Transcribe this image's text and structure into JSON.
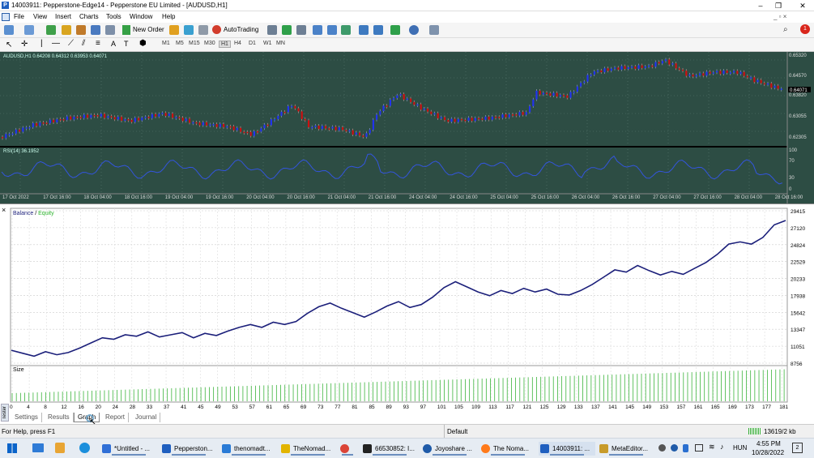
{
  "window": {
    "title": "14003911: Pepperstone-Edge14 - Pepperstone EU Limited - [AUDUSD,H1]",
    "app_icon": "P"
  },
  "menu": [
    "File",
    "View",
    "Insert",
    "Charts",
    "Tools",
    "Window",
    "Help"
  ],
  "toolbar": {
    "new_order": "New Order",
    "autotrading": "AutoTrading",
    "timeframes": [
      "M1",
      "M5",
      "M15",
      "M30",
      "H1",
      "H4",
      "D1",
      "W1",
      "MN"
    ],
    "active_timeframe": "H1",
    "notification_count": "1"
  },
  "chart": {
    "header": "AUDUSD,H1  0.64208 0.64312 0.63953 0.64071",
    "price_ticks": [
      "0.65320",
      "0.64570",
      "0.64071",
      "0.63820",
      "0.63055",
      "0.62305"
    ],
    "current_price": "0.64071",
    "rsi_label": "RSI(14) 36.1952",
    "rsi_ticks": [
      "100",
      "70",
      "30",
      "0"
    ],
    "time_ticks": [
      "17 Oct 2022",
      "17 Oct 16:00",
      "18 Oct 04:00",
      "18 Oct 16:00",
      "19 Oct 04:00",
      "19 Oct 16:00",
      "20 Oct 04:00",
      "20 Oct 16:00",
      "21 Oct 04:00",
      "21 Oct 16:00",
      "24 Oct 04:00",
      "24 Oct 16:00",
      "25 Oct 04:00",
      "25 Oct 16:00",
      "26 Oct 04:00",
      "26 Oct 16:00",
      "27 Oct 04:00",
      "27 Oct 16:00",
      "28 Oct 04:00",
      "28 Oct 16:00"
    ],
    "colors": {
      "background": "#2d4d44",
      "up": "#2233ee",
      "down": "#cc1111",
      "rsi": "#3355dd"
    }
  },
  "tester": {
    "legend_balance": "Balance",
    "legend_sep": " / ",
    "legend_equity": "Equity",
    "size_label": "Size",
    "side_label": "Tester",
    "tabs": [
      "Settings",
      "Results",
      "Graph",
      "Report",
      "Journal"
    ],
    "active_tab": "Graph",
    "colors": {
      "balance": "#1b1f7a",
      "equity": "#2bb32b",
      "size": "#3cb43c"
    }
  },
  "chart_data": [
    {
      "type": "line",
      "title": "",
      "xlabel": "",
      "ylabel": "",
      "series": [
        {
          "name": "Balance",
          "values": [
            10500,
            10100,
            9700,
            10300,
            9900,
            10200,
            10800,
            11500,
            12200,
            12000,
            12600,
            12400,
            13000,
            12300,
            12600,
            12900,
            12200,
            12800,
            12500,
            13100,
            13600,
            14000,
            13600,
            14300,
            14000,
            14400,
            15500,
            16400,
            16900,
            16200,
            15600,
            15000,
            15700,
            16500,
            17100,
            16300,
            16700,
            17700,
            19000,
            19800,
            19100,
            18400,
            17900,
            18600,
            18200,
            18900,
            18400,
            18800,
            18100,
            18000,
            18600,
            19400,
            20400,
            21400,
            21100,
            22000,
            21300,
            20700,
            21200,
            20800,
            21600,
            22400,
            23500,
            24900,
            25200,
            24900,
            25800,
            27500,
            28100
          ]
        }
      ],
      "x_ticks": [
        "0",
        "4",
        "8",
        "12",
        "16",
        "20",
        "24",
        "28",
        "33",
        "37",
        "41",
        "45",
        "49",
        "53",
        "57",
        "61",
        "65",
        "69",
        "73",
        "77",
        "81",
        "85",
        "89",
        "93",
        "97",
        "101",
        "105",
        "109",
        "113",
        "117",
        "121",
        "125",
        "129",
        "133",
        "137",
        "141",
        "145",
        "149",
        "153",
        "157",
        "161",
        "165",
        "169",
        "173",
        "177",
        "181"
      ],
      "y_ticks": [
        "29415",
        "27120",
        "24824",
        "22529",
        "20233",
        "17938",
        "15642",
        "13347",
        "11051",
        "8756"
      ],
      "ylim": [
        8756,
        29415
      ]
    }
  ],
  "status": {
    "help": "For Help, press F1",
    "profile": "Default",
    "traffic": "13619/2 kb"
  },
  "taskbar": {
    "items": [
      {
        "label": "*Untitled - ...",
        "color": "#2f6fd6"
      },
      {
        "label": "Pepperston...",
        "color": "#1f5fbf"
      },
      {
        "label": "thenomadt...",
        "color": "#2a7bd6"
      },
      {
        "label": "TheNomad...",
        "color": "#e2b400"
      },
      {
        "label": "",
        "color": "#db4437"
      },
      {
        "label": "66530852: I...",
        "color": "#222222"
      },
      {
        "label": "Joyoshare ...",
        "color": "#1e5aa8"
      },
      {
        "label": "The Noma...",
        "color": "#ff7a1a"
      },
      {
        "label": "14003911: ...",
        "color": "#1f5fbf"
      },
      {
        "label": "MetaEditor...",
        "color": "#c89b2a"
      }
    ],
    "lang": "HUN",
    "time": "4:55 PM",
    "date": "10/28/2022",
    "badge": "2"
  }
}
